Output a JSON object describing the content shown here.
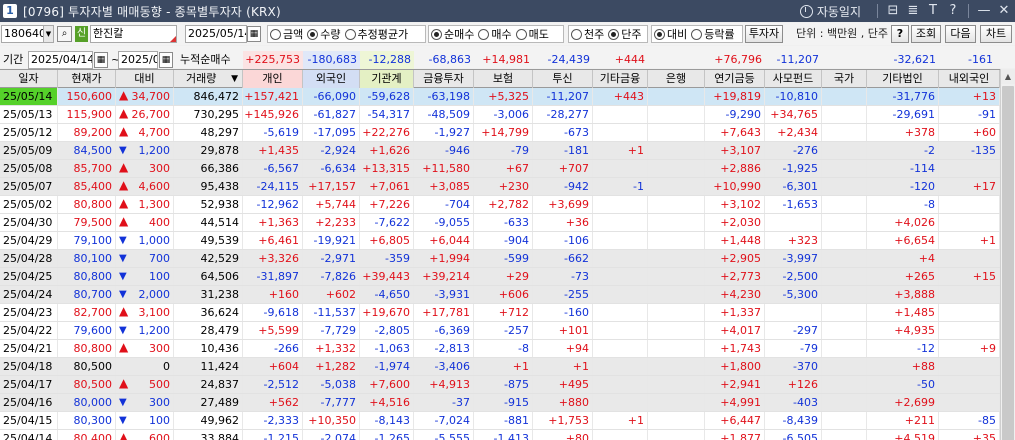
{
  "window": {
    "screen_no": "1",
    "title": "[0796] 투자자별 매매동향 - 종목별투자자 (KRX)",
    "auto_label": "자동일지",
    "controls": [
      "⊟",
      "≣",
      "T",
      "?",
      "—",
      "✕"
    ]
  },
  "toolbar": {
    "code": "180640",
    "shin_badge": "신",
    "stock_name": "한진칼",
    "date": "2025/05/14",
    "amount_options": [
      {
        "label": "금액",
        "selected": false
      },
      {
        "label": "수량",
        "selected": true
      },
      {
        "label": "추정평균가",
        "selected": false
      }
    ],
    "trade_options": [
      {
        "label": "순매수",
        "selected": true
      },
      {
        "label": "매수",
        "selected": false
      },
      {
        "label": "매도",
        "selected": false
      }
    ],
    "unit_options": [
      {
        "label": "천주",
        "selected": false
      },
      {
        "label": "단주",
        "selected": true
      }
    ],
    "compare_options": [
      {
        "label": "대비",
        "selected": true
      },
      {
        "label": "등락률",
        "selected": false
      }
    ],
    "investor_button": "투자자",
    "unit_text": "단위 : 백만원 , 단주",
    "help_button": "?",
    "query_button": "조회",
    "next_button": "다음",
    "chart_button": "차트"
  },
  "period": {
    "label": "기간",
    "from": "2025/04/14",
    "tilde": "~",
    "to": "2025/05/14",
    "cumulative_label": "누적순매수"
  },
  "summary": {
    "individual": "+225,753",
    "foreign": "-180,683",
    "institution": "-12,288",
    "financial_invest": "-68,863",
    "insurance": "+14,981",
    "trust": "-24,439",
    "other_finance": "+444",
    "bank": "",
    "pension": "+76,796",
    "private_fund": "-11,207",
    "nation": "",
    "other_corp": "-32,621",
    "domestic_foreign": "-161"
  },
  "columns": [
    "일자",
    "현재가",
    "대비",
    "거래량",
    "개인",
    "외국인",
    "기관계",
    "금융투자",
    "보험",
    "투신",
    "기타금융",
    "은행",
    "연기금등",
    "사모펀드",
    "국가",
    "기타법인",
    "내외국인"
  ],
  "colors": {
    "up": "#e0101a",
    "down": "#1232d8",
    "highlight_date_bg": "#55d12a",
    "selected_row_bg": "#cfe6f5",
    "alt_row_bg": "#e9e9e9",
    "summary_individual_bg": "#fbe3e3",
    "summary_foreign_bg": "#e0e8f8",
    "summary_institution_bg": "#eef6d6"
  },
  "rows": [
    {
      "date": "25/05/14",
      "price": "150,600",
      "dir": "up",
      "change": "34,700",
      "volume": "846,472",
      "individual": "+157,421",
      "foreign": "-66,090",
      "institution": "-59,628",
      "financial_invest": "-63,198",
      "insurance": "+5,325",
      "trust": "-11,207",
      "other_finance": "+443",
      "bank": "",
      "pension": "+19,819",
      "private_fund": "-10,810",
      "nation": "",
      "other_corp": "-31,776",
      "domestic_foreign": "+13"
    },
    {
      "date": "25/05/13",
      "price": "115,900",
      "dir": "up",
      "change": "26,700",
      "volume": "730,295",
      "individual": "+145,926",
      "foreign": "-61,827",
      "institution": "-54,317",
      "financial_invest": "-48,509",
      "insurance": "-3,006",
      "trust": "-28,277",
      "other_finance": "",
      "bank": "",
      "pension": "-9,290",
      "private_fund": "+34,765",
      "nation": "",
      "other_corp": "-29,691",
      "domestic_foreign": "-91"
    },
    {
      "date": "25/05/12",
      "price": "89,200",
      "dir": "up",
      "change": "4,700",
      "volume": "48,297",
      "individual": "-5,619",
      "foreign": "-17,095",
      "institution": "+22,276",
      "financial_invest": "-1,927",
      "insurance": "+14,799",
      "trust": "-673",
      "other_finance": "",
      "bank": "",
      "pension": "+7,643",
      "private_fund": "+2,434",
      "nation": "",
      "other_corp": "+378",
      "domestic_foreign": "+60"
    },
    {
      "date": "25/05/09",
      "price": "84,500",
      "dir": "down",
      "change": "1,200",
      "volume": "29,878",
      "individual": "+1,435",
      "foreign": "-2,924",
      "institution": "+1,626",
      "financial_invest": "-946",
      "insurance": "-79",
      "trust": "-181",
      "other_finance": "+1",
      "bank": "",
      "pension": "+3,107",
      "private_fund": "-276",
      "nation": "",
      "other_corp": "-2",
      "domestic_foreign": "-135"
    },
    {
      "date": "25/05/08",
      "price": "85,700",
      "dir": "up",
      "change": "300",
      "volume": "66,386",
      "individual": "-6,567",
      "foreign": "-6,634",
      "institution": "+13,315",
      "financial_invest": "+11,580",
      "insurance": "+67",
      "trust": "+707",
      "other_finance": "",
      "bank": "",
      "pension": "+2,886",
      "private_fund": "-1,925",
      "nation": "",
      "other_corp": "-114",
      "domestic_foreign": ""
    },
    {
      "date": "25/05/07",
      "price": "85,400",
      "dir": "up",
      "change": "4,600",
      "volume": "95,438",
      "individual": "-24,115",
      "foreign": "+17,157",
      "institution": "+7,061",
      "financial_invest": "+3,085",
      "insurance": "+230",
      "trust": "-942",
      "other_finance": "-1",
      "bank": "",
      "pension": "+10,990",
      "private_fund": "-6,301",
      "nation": "",
      "other_corp": "-120",
      "domestic_foreign": "+17"
    },
    {
      "date": "25/05/02",
      "price": "80,800",
      "dir": "up",
      "change": "1,300",
      "volume": "52,938",
      "individual": "-12,962",
      "foreign": "+5,744",
      "institution": "+7,226",
      "financial_invest": "-704",
      "insurance": "+2,782",
      "trust": "+3,699",
      "other_finance": "",
      "bank": "",
      "pension": "+3,102",
      "private_fund": "-1,653",
      "nation": "",
      "other_corp": "-8",
      "domestic_foreign": ""
    },
    {
      "date": "25/04/30",
      "price": "79,500",
      "dir": "up",
      "change": "400",
      "volume": "44,514",
      "individual": "+1,363",
      "foreign": "+2,233",
      "institution": "-7,622",
      "financial_invest": "-9,055",
      "insurance": "-633",
      "trust": "+36",
      "other_finance": "",
      "bank": "",
      "pension": "+2,030",
      "private_fund": "",
      "nation": "",
      "other_corp": "+4,026",
      "domestic_foreign": ""
    },
    {
      "date": "25/04/29",
      "price": "79,100",
      "dir": "down",
      "change": "1,000",
      "volume": "49,539",
      "individual": "+6,461",
      "foreign": "-19,921",
      "institution": "+6,805",
      "financial_invest": "+6,044",
      "insurance": "-904",
      "trust": "-106",
      "other_finance": "",
      "bank": "",
      "pension": "+1,448",
      "private_fund": "+323",
      "nation": "",
      "other_corp": "+6,654",
      "domestic_foreign": "+1"
    },
    {
      "date": "25/04/28",
      "price": "80,100",
      "dir": "down",
      "change": "700",
      "volume": "42,529",
      "individual": "+3,326",
      "foreign": "-2,971",
      "institution": "-359",
      "financial_invest": "+1,994",
      "insurance": "-599",
      "trust": "-662",
      "other_finance": "",
      "bank": "",
      "pension": "+2,905",
      "private_fund": "-3,997",
      "nation": "",
      "other_corp": "+4",
      "domestic_foreign": ""
    },
    {
      "date": "25/04/25",
      "price": "80,800",
      "dir": "down",
      "change": "100",
      "volume": "64,506",
      "individual": "-31,897",
      "foreign": "-7,826",
      "institution": "+39,443",
      "financial_invest": "+39,214",
      "insurance": "+29",
      "trust": "-73",
      "other_finance": "",
      "bank": "",
      "pension": "+2,773",
      "private_fund": "-2,500",
      "nation": "",
      "other_corp": "+265",
      "domestic_foreign": "+15"
    },
    {
      "date": "25/04/24",
      "price": "80,700",
      "dir": "down",
      "change": "2,000",
      "volume": "31,238",
      "individual": "+160",
      "foreign": "+602",
      "institution": "-4,650",
      "financial_invest": "-3,931",
      "insurance": "+606",
      "trust": "-255",
      "other_finance": "",
      "bank": "",
      "pension": "+4,230",
      "private_fund": "-5,300",
      "nation": "",
      "other_corp": "+3,888",
      "domestic_foreign": ""
    },
    {
      "date": "25/04/23",
      "price": "82,700",
      "dir": "up",
      "change": "3,100",
      "volume": "36,624",
      "individual": "-9,618",
      "foreign": "-11,537",
      "institution": "+19,670",
      "financial_invest": "+17,781",
      "insurance": "+712",
      "trust": "-160",
      "other_finance": "",
      "bank": "",
      "pension": "+1,337",
      "private_fund": "",
      "nation": "",
      "other_corp": "+1,485",
      "domestic_foreign": ""
    },
    {
      "date": "25/04/22",
      "price": "79,600",
      "dir": "down",
      "change": "1,200",
      "volume": "28,479",
      "individual": "+5,599",
      "foreign": "-7,729",
      "institution": "-2,805",
      "financial_invest": "-6,369",
      "insurance": "-257",
      "trust": "+101",
      "other_finance": "",
      "bank": "",
      "pension": "+4,017",
      "private_fund": "-297",
      "nation": "",
      "other_corp": "+4,935",
      "domestic_foreign": ""
    },
    {
      "date": "25/04/21",
      "price": "80,800",
      "dir": "up",
      "change": "300",
      "volume": "10,436",
      "individual": "-266",
      "foreign": "+1,332",
      "institution": "-1,063",
      "financial_invest": "-2,813",
      "insurance": "-8",
      "trust": "+94",
      "other_finance": "",
      "bank": "",
      "pension": "+1,743",
      "private_fund": "-79",
      "nation": "",
      "other_corp": "-12",
      "domestic_foreign": "+9"
    },
    {
      "date": "25/04/18",
      "price": "80,500",
      "dir": "flat",
      "change": "0",
      "volume": "11,424",
      "individual": "+604",
      "foreign": "+1,282",
      "institution": "-1,974",
      "financial_invest": "-3,406",
      "insurance": "+1",
      "trust": "+1",
      "other_finance": "",
      "bank": "",
      "pension": "+1,800",
      "private_fund": "-370",
      "nation": "",
      "other_corp": "+88",
      "domestic_foreign": ""
    },
    {
      "date": "25/04/17",
      "price": "80,500",
      "dir": "up",
      "change": "500",
      "volume": "24,837",
      "individual": "-2,512",
      "foreign": "-5,038",
      "institution": "+7,600",
      "financial_invest": "+4,913",
      "insurance": "-875",
      "trust": "+495",
      "other_finance": "",
      "bank": "",
      "pension": "+2,941",
      "private_fund": "+126",
      "nation": "",
      "other_corp": "-50",
      "domestic_foreign": ""
    },
    {
      "date": "25/04/16",
      "price": "80,000",
      "dir": "down",
      "change": "300",
      "volume": "27,489",
      "individual": "+562",
      "foreign": "-7,777",
      "institution": "+4,516",
      "financial_invest": "-37",
      "insurance": "-915",
      "trust": "+880",
      "other_finance": "",
      "bank": "",
      "pension": "+4,991",
      "private_fund": "-403",
      "nation": "",
      "other_corp": "+2,699",
      "domestic_foreign": ""
    },
    {
      "date": "25/04/15",
      "price": "80,300",
      "dir": "down",
      "change": "100",
      "volume": "49,962",
      "individual": "-2,333",
      "foreign": "+10,350",
      "institution": "-8,143",
      "financial_invest": "-7,024",
      "insurance": "-881",
      "trust": "+1,753",
      "other_finance": "+1",
      "bank": "",
      "pension": "+6,447",
      "private_fund": "-8,439",
      "nation": "",
      "other_corp": "+211",
      "domestic_foreign": "-85"
    },
    {
      "date": "25/04/14",
      "price": "80,400",
      "dir": "up",
      "change": "600",
      "volume": "33,884",
      "individual": "-1,215",
      "foreign": "-2,074",
      "institution": "-1,265",
      "financial_invest": "-5,555",
      "insurance": "-1,413",
      "trust": "+80",
      "other_finance": "",
      "bank": "",
      "pension": "+1,877",
      "private_fund": "-6,505",
      "nation": "",
      "other_corp": "+4,519",
      "domestic_foreign": "+35"
    }
  ]
}
